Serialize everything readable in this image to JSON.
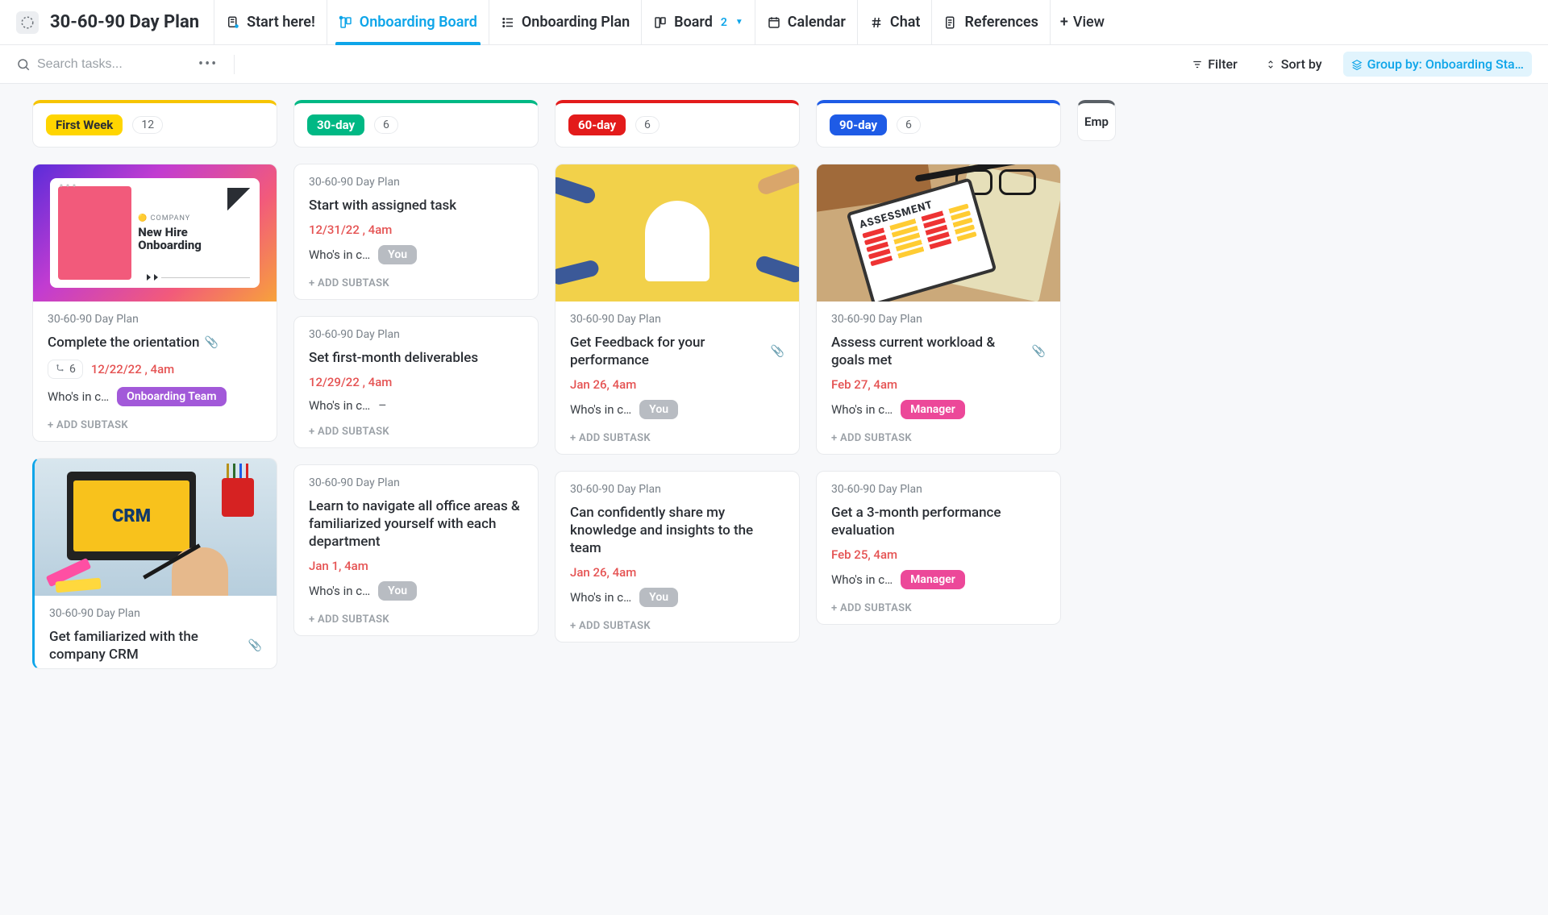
{
  "header": {
    "title": "30-60-90 Day Plan",
    "tabs": [
      {
        "label": "Start here!",
        "icon": "doc-pin"
      },
      {
        "label": "Onboarding Board",
        "icon": "board-pin",
        "active": true
      },
      {
        "label": "Onboarding Plan",
        "icon": "list"
      },
      {
        "label": "Board",
        "icon": "board",
        "badge": "2"
      },
      {
        "label": "Calendar",
        "icon": "calendar"
      },
      {
        "label": "Chat",
        "icon": "hash"
      },
      {
        "label": "References",
        "icon": "doc"
      }
    ],
    "add_view": "View"
  },
  "toolbar": {
    "search_placeholder": "Search tasks...",
    "filter": "Filter",
    "sort": "Sort by",
    "group_by": "Group by: Onboarding Sta…"
  },
  "columns": [
    {
      "key": "first",
      "stage": "First Week",
      "count": "12",
      "class": "first"
    },
    {
      "key": "c30",
      "stage": "30-day",
      "count": "6",
      "class": "c30"
    },
    {
      "key": "c60",
      "stage": "60-day",
      "count": "6",
      "class": "c60"
    },
    {
      "key": "c90",
      "stage": "90-day",
      "count": "6",
      "class": "c90"
    }
  ],
  "edge_stage": "Emp",
  "labels": {
    "folder": "30-60-90 Day Plan",
    "who": "Who's in c…",
    "add_subtask": "+ ADD SUBTASK",
    "assignee_you": "You",
    "assignee_team": "Onboarding Team",
    "assignee_manager": "Manager"
  },
  "cards": {
    "first": [
      {
        "cover": "hire",
        "title": "Complete the orientation",
        "clip": true,
        "subcount": "6",
        "date": "12/22/22 , 4am",
        "assignee": "team"
      },
      {
        "cover": "crm",
        "active_left": true,
        "title": "Get familiarized with the company CRM",
        "clip": true
      }
    ],
    "c30": [
      {
        "title": "Start with assigned task",
        "date": "12/31/22 , 4am",
        "assignee": "you"
      },
      {
        "title": "Set first-month deliverables",
        "date": "12/29/22 , 4am",
        "assignee": "dash"
      },
      {
        "title": "Learn to navigate all office areas & familiarized yourself with each department",
        "date": "Jan 1, 4am",
        "assignee": "you"
      }
    ],
    "c60": [
      {
        "cover": "yellow",
        "title": "Get Feedback for your performance",
        "clip": true,
        "date": "Jan 26, 4am",
        "assignee": "you"
      },
      {
        "title": "Can confidently share my knowledge and insights to the team",
        "date": "Jan 26, 4am",
        "assignee": "you"
      }
    ],
    "c90": [
      {
        "cover": "desk",
        "title": "Assess current workload & goals met",
        "clip": true,
        "date": "Feb 27, 4am",
        "assignee": "manager"
      },
      {
        "title": "Get a 3-month performance evaluation",
        "date": "Feb 25, 4am",
        "assignee": "manager"
      }
    ]
  },
  "cover_text": {
    "hire_tag": "🟡 COMPANY",
    "hire_line": "New Hire Onboarding",
    "crm": "CRM",
    "assessment": "ASSESSMENT"
  }
}
